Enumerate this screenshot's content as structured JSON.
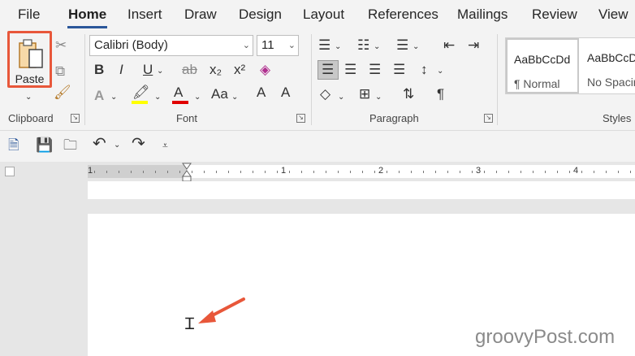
{
  "tabs": [
    "File",
    "Home",
    "Insert",
    "Draw",
    "Design",
    "Layout",
    "References",
    "Mailings",
    "Review",
    "View"
  ],
  "ribbon": {
    "clipboard": {
      "paste_label": "Paste",
      "group_label": "Clipboard"
    },
    "font": {
      "family": "Calibri (Body)",
      "size": "11",
      "group_label": "Font",
      "bold": "B",
      "italic": "I",
      "underline": "U",
      "strike": "ab",
      "subscript": "x₂",
      "superscript": "x²",
      "change_case": "Aa",
      "grow": "A",
      "shrink": "A",
      "text_effects": "A",
      "font_color": "A"
    },
    "paragraph": {
      "group_label": "Paragraph",
      "pilcrow": "¶"
    },
    "styles": {
      "group_label": "Styles",
      "items": [
        {
          "sample": "AaBbCcDd",
          "name": "¶ Normal"
        },
        {
          "sample": "AaBbCcDd",
          "name": "No Spacing"
        }
      ]
    }
  },
  "ruler": {
    "numbers": [
      "1",
      "1",
      "2",
      "3",
      "4"
    ]
  },
  "watermark": "groovyPost.com",
  "colors": {
    "accent": "#2b579a",
    "highlight": "#e8573a",
    "font_color_bar": "#e00000",
    "highlight_bar": "#ffff00"
  }
}
